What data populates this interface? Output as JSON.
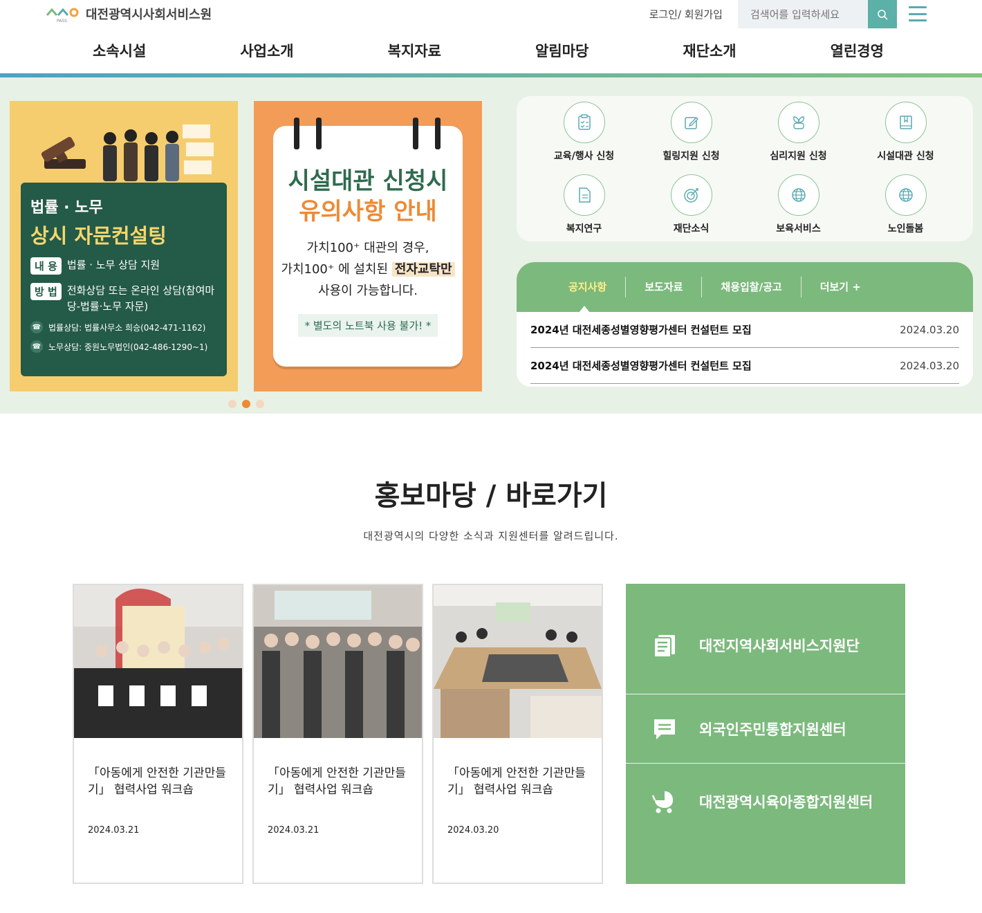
{
  "header": {
    "logo_text": "대전광역시사회서비스원",
    "logo_sub": "PASS",
    "login": "로그인/ 회원가입",
    "search_placeholder": "검색어를 입력하세요"
  },
  "gnb": [
    "소속시설",
    "사업소개",
    "복지자료",
    "알림마당",
    "재단소개",
    "열린경영"
  ],
  "banner1": {
    "title1": "법률 · 노무",
    "title2": "상시 자문컨설팅",
    "row1_tag": "내 용",
    "row1_text": "법률 · 노무 상담 지원",
    "row2_tag": "방 법",
    "row2_text": "전화상담 또는 온라인 상담(참여마당-법률·노무 자문)",
    "phone1": "법률상담: 법률사무소 희승(042-471-1162)",
    "phone2": "노무상담: 중원노무법인(042-486-1290~1)"
  },
  "banner2": {
    "title1": "시설대관 신청시",
    "title2": "유의사항 안내",
    "line1": "가치100⁺ 대관의 경우,",
    "line2a": "가치100⁺ 에 설치된",
    "line2b": "전자교탁만",
    "line3": "사용이 가능합니다.",
    "note": "* 별도의 노트북 사용 불가! *"
  },
  "slider": {
    "total": 3,
    "active": 2
  },
  "quick_links": [
    {
      "label": "교육/행사 신청",
      "icon": "clipboard-check-icon"
    },
    {
      "label": "힐링지원 신청",
      "icon": "edit-icon"
    },
    {
      "label": "심리지원 신청",
      "icon": "sprout-icon"
    },
    {
      "label": "시설대관 신청",
      "icon": "book-icon"
    },
    {
      "label": "복지연구",
      "icon": "document-icon"
    },
    {
      "label": "재단소식",
      "icon": "target-icon"
    },
    {
      "label": "보육서비스",
      "icon": "globe-icon"
    },
    {
      "label": "노인돌봄",
      "icon": "globe-icon"
    }
  ],
  "board": {
    "tabs": [
      "공지사항",
      "보도자료",
      "채용입찰/공고",
      "더보기 +"
    ],
    "rows": [
      {
        "title": "2024년 대전세종성별영향평가센터 컨설턴트 모집",
        "date": "2024.03.20"
      },
      {
        "title": "2024년 대전세종성별영향평가센터 컨설턴트 모집",
        "date": "2024.03.20"
      }
    ]
  },
  "section": {
    "title": "홍보마당 / 바로가기",
    "desc": "대전광역시의 다양한 소식과 지원센터를 알려드립니다."
  },
  "news_cards": [
    {
      "title": "「아동에게 안전한 기관만들기」 협력사업 워크숍",
      "date": "2024.03.21"
    },
    {
      "title": "「아동에게 안전한 기관만들기」 협력사업 워크숍",
      "date": "2024.03.21"
    },
    {
      "title": "「아동에게 안전한 기관만들기」 협력사업 워크숍",
      "date": "2024.03.20"
    }
  ],
  "shortcuts": [
    {
      "label": "대전지역사회서비스지원단",
      "icon": "list-icon"
    },
    {
      "label": "외국인주민통합지원센터",
      "icon": "message-icon"
    },
    {
      "label": "대전광역시육아종합지원센터",
      "icon": "stroller-icon"
    }
  ],
  "colors": {
    "accent_green": "#7cb97d",
    "accent_teal": "#5bb0a8",
    "accent_orange": "#ee8a34"
  }
}
